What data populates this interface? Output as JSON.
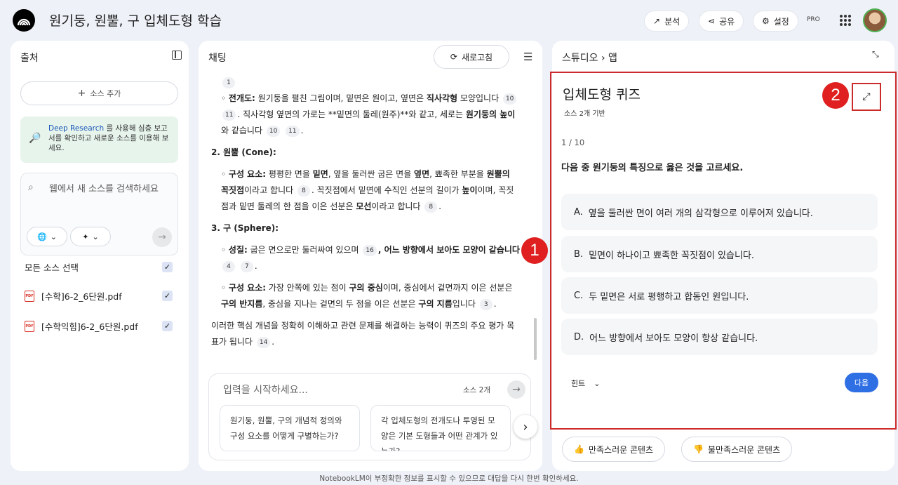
{
  "header": {
    "title": "원기둥, 원뿔, 구 입체도형 학습",
    "analyze_label": "분석",
    "share_label": "공유",
    "settings_label": "설정",
    "pro_label": "PRO"
  },
  "sources": {
    "title": "출처",
    "add_label": "소스 추가",
    "deep_research_link": "Deep Research",
    "deep_research_text": " 를 사용해 심층 보고서를 확인하고 새로운 소스를 이용해 보세요.",
    "search_placeholder": "웹에서 새 소스를 검색하세요",
    "select_all_label": "모든 소스 선택",
    "items": [
      {
        "name": "[수학]6-2_6단원.pdf"
      },
      {
        "name": "[수학익힘]6-2_6단원.pdf"
      }
    ]
  },
  "chat": {
    "title": "채팅",
    "refresh_label": "새로고침",
    "input_placeholder": "입력을 시작하세요...",
    "source_count": "소스 2개",
    "suggestions": [
      "원기둥, 원뿔, 구의 개념적 정의와 구성 요소를 어떻게 구별하는가?",
      "각 입체도형의 전개도나 투영된 모양은 기본 도형들과 어떤 관계가 있는가?"
    ],
    "content": {
      "c0": "1",
      "net_label": "전개도:",
      "net_text1": " 원기둥을 펼친 그림이며, 밑면은 원이고, 옆면은 ",
      "net_bold1": "직사각형",
      "net_text2": " 모양입니다",
      "c10": "10",
      "c11": "11",
      "net_text3": ". 직사각형 옆면의 가로는 **밑면의 둘레(원주)**와 같고, 세로는 ",
      "net_bold2": "원기둥의 높이",
      "net_text4": "와 같습니다",
      "cone_heading": "2. 원뿔 (Cone):",
      "cone_label": "구성 요소:",
      "cone_t1": " 평평한 면을 ",
      "cone_b1": "밑면",
      "cone_t2": ", 옆을 둘러싼 굽은 면을 ",
      "cone_b2": "옆면",
      "cone_t3": ", 뾰족한 부분을 ",
      "cone_b3": "원뿔의 꼭짓점",
      "cone_t4": "이라고 합니다",
      "c8": "8",
      "cone_t5": ". 꼭짓점에서 밑면에 수직인 선분의 길이가 ",
      "cone_b4": "높이",
      "cone_t6": "이며, 꼭짓점과 밑면 둘레의 한 점을 이은 선분은 ",
      "cone_b5": "모선",
      "cone_t7": "이라고 합니다",
      "sphere_heading": "3. 구 (Sphere):",
      "prop_label": "성질:",
      "prop_t1": " 굽은 면으로만 둘러싸여 있으며",
      "c16": "16",
      "prop_b1": ", 어느 방향에서 보아도 모양이 같습니다",
      "c4": "4",
      "c7": "7",
      "comp_label": "구성 요소:",
      "comp_t1": " 가장 안쪽에 있는 점이 ",
      "comp_b1": "구의 중심",
      "comp_t2": "이며, 중심에서 겉면까지 이은 선분은 ",
      "comp_b2": "구의 반지름",
      "comp_t3": ", 중심을 지나는 겉면의 두 점을 이은 선분은 ",
      "comp_b3": "구의 지름",
      "comp_t4": "입니다",
      "c3": "3",
      "summary": "이러한 핵심 개념을 정확히 이해하고 관련 문제를 해결하는 능력이 퀴즈의 주요 평가 목표가 됩니다",
      "c14": "14"
    }
  },
  "studio": {
    "breadcrumb_root": "스튜디오",
    "breadcrumb_page": "앱",
    "quiz_title": "입체도형 퀴즈",
    "quiz_sub": "소스 2개 기반",
    "progress": "1 / 10",
    "question": "다음 중 원기둥의 특징으로 옳은 것을 고르세요.",
    "options": [
      {
        "letter": "A.",
        "text": "옆을 둘러싼 면이 여러 개의 삼각형으로 이루어져 있습니다."
      },
      {
        "letter": "B.",
        "text": "밑면이 하나이고 뾰족한 꼭짓점이 있습니다."
      },
      {
        "letter": "C.",
        "text": "두 밑면은 서로 평행하고 합동인 원입니다."
      },
      {
        "letter": "D.",
        "text": "어느 방향에서 보아도 모양이 항상 같습니다."
      }
    ],
    "hint_label": "힌트",
    "next_label": "다음",
    "good_label": "만족스러운 콘텐츠",
    "bad_label": "불만족스러운 콘텐츠"
  },
  "annotations": {
    "one": "1",
    "two": "2"
  },
  "footer": "NotebookLM이 부정확한 정보를 표시할 수 있으므로 대답을 다시 한번 확인하세요.",
  "colors": {
    "accent": "#2f6fe4",
    "annotation_red": "#e02020",
    "background": "#eef1f8"
  }
}
